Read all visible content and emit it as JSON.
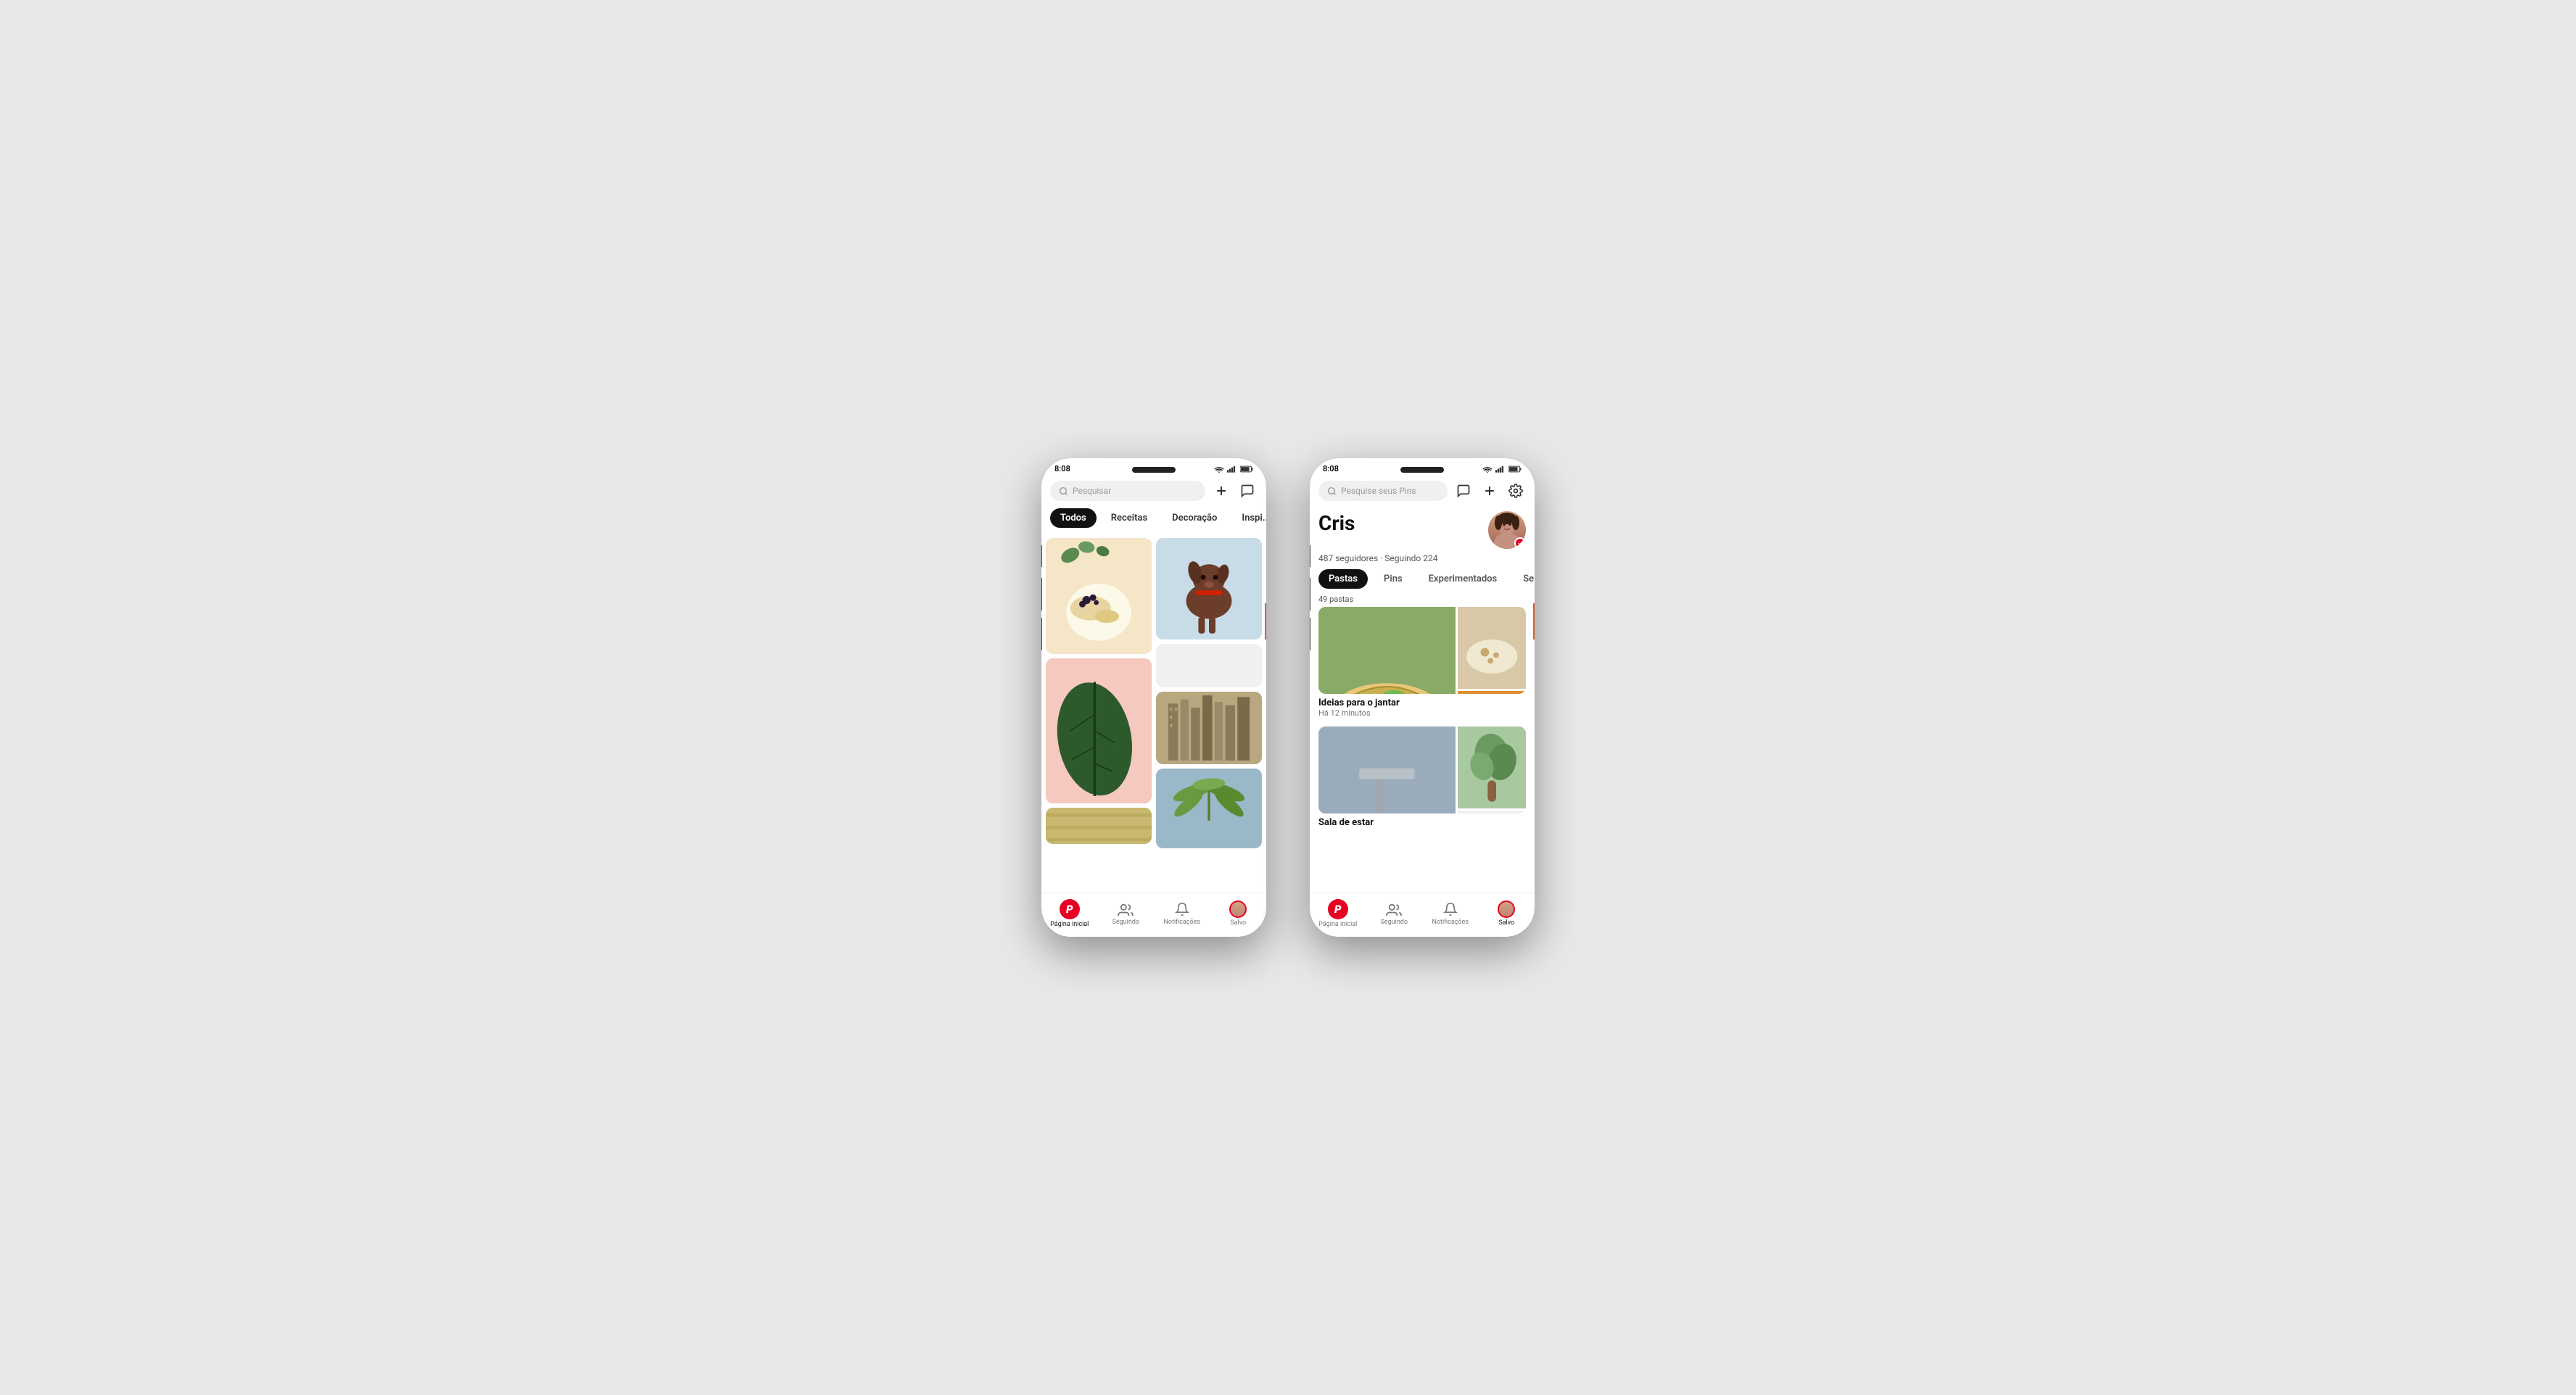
{
  "page": {
    "background": "#e8e8e8"
  },
  "phone1": {
    "status": {
      "time": "8:08"
    },
    "search": {
      "placeholder": "Pesquisar"
    },
    "tabs": [
      {
        "label": "Todos",
        "active": true
      },
      {
        "label": "Receitas",
        "active": false
      },
      {
        "label": "Decoração",
        "active": false
      },
      {
        "label": "Inspi...",
        "active": false
      }
    ],
    "bottomNav": [
      {
        "label": "Página inicial",
        "active": true
      },
      {
        "label": "Seguindo",
        "active": false
      },
      {
        "label": "Notificações",
        "active": false
      },
      {
        "label": "Salvo",
        "active": false
      }
    ]
  },
  "phone2": {
    "status": {
      "time": "8:08"
    },
    "search": {
      "placeholder": "Pesquise seus Pins"
    },
    "profile": {
      "name": "Cris",
      "followers": "487 seguidores",
      "following": "Seguindo 224"
    },
    "tabs": [
      {
        "label": "Pastas",
        "active": true
      },
      {
        "label": "Pins",
        "active": false
      },
      {
        "label": "Experimentados",
        "active": false
      },
      {
        "label": "Se...",
        "active": false
      }
    ],
    "boards": [
      {
        "title": "Ideias para o jantar",
        "date": "Há 12 minutos"
      },
      {
        "title": "Sala de estar",
        "date": ""
      }
    ],
    "pastasCount": "49 pastas",
    "bottomNav": [
      {
        "label": "Página inicial",
        "active": false
      },
      {
        "label": "Seguindo",
        "active": false
      },
      {
        "label": "Notificações",
        "active": false
      },
      {
        "label": "Salvo",
        "active": true
      }
    ]
  },
  "icons": {
    "search": "🔍",
    "plus": "+",
    "message": "💬",
    "gear": "⚙",
    "pinterest": "P",
    "follow": "👥",
    "bell": "🔔",
    "check": "✓"
  }
}
